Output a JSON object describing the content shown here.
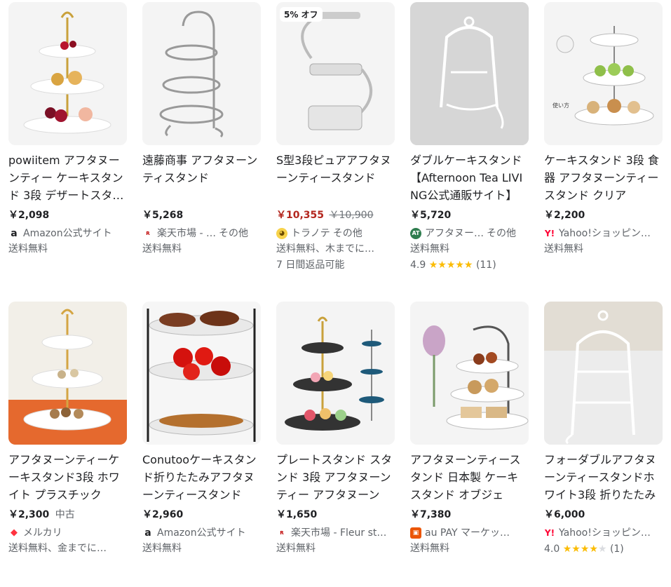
{
  "colors": {
    "sale_price": "#b3261e",
    "star": "#fbbc04",
    "background": "#ffffff",
    "thumb_bg": "#f3f3f3"
  },
  "products": [
    {
      "title": "powiitem アフタヌーンティー ケーキスタンド 3段 デザートスタンド",
      "price": "￥2,098",
      "seller_icon": "amazon-icon",
      "seller": "Amazon公式サイト",
      "more": "",
      "shipping": "送料無料"
    },
    {
      "title": "遠藤商事 アフタヌーンティスタンド",
      "price": "￥5,268",
      "seller_icon": "rakuten-icon",
      "seller": "楽天市場 - …",
      "more": "その他",
      "shipping": "送料無料"
    },
    {
      "badge": "5% オフ",
      "title": "S型3段ピュアアフタヌーンティースタンド",
      "price": "￥10,355",
      "original_price": "￥10,900",
      "seller_icon": "tranote-icon",
      "seller": "トラノテ",
      "more": "その他",
      "shipping": "送料無料、木までに…",
      "extra": "7 日間返品可能"
    },
    {
      "title": "ダブルケーキスタンド【Afternoon Tea LIVING公式通販サイト】",
      "price": "￥5,720",
      "seller_icon": "afternoon-tea-icon",
      "seller": "アフタヌー…",
      "more": "その他",
      "shipping": "送料無料",
      "rating": "4.9",
      "stars": 5,
      "reviews": "(11)"
    },
    {
      "title": "ケーキスタンド 3段 食器 アフタヌーンティースタンド クリア",
      "price": "￥2,200",
      "seller_icon": "yahoo-icon",
      "seller": "Yahoo!ショッピン…",
      "more": "",
      "shipping": "送料無料"
    },
    {
      "title": "アフタヌーンティーケーキスタンド3段 ホワイト プラスチック",
      "price": "￥2,300",
      "condition": "中古",
      "seller_icon": "mercari-icon",
      "seller": "メルカリ",
      "more": "",
      "shipping": "送料無料、金までに…"
    },
    {
      "title": "Conutooケーキスタンド折りたたみアフタヌーンティースタンド",
      "price": "￥2,960",
      "seller_icon": "amazon-icon",
      "seller": "Amazon公式サイト",
      "more": "",
      "shipping": "送料無料"
    },
    {
      "title": "プレートスタンド スタンド 3段 アフタヌーンティー アフタヌーン",
      "price": "￥1,650",
      "seller_icon": "rakuten-icon",
      "seller": "楽天市場 - Fleur st…",
      "more": "",
      "shipping": "送料無料"
    },
    {
      "title": "アフタヌーンティースタンド 日本製 ケーキスタンド オブジェ",
      "price": "￥7,380",
      "seller_icon": "aupay-icon",
      "seller": "au PAY マーケッ…",
      "more": "",
      "shipping": "送料無料"
    },
    {
      "title": "フォーダブルアフタヌーンティースタンドホワイト3段 折りたたみ",
      "price": "￥6,000",
      "seller_icon": "yahoo-icon",
      "seller": "Yahoo!ショッピン…",
      "more": "",
      "shipping": "",
      "rating": "4.0",
      "stars": 4,
      "reviews": "(1)"
    }
  ]
}
